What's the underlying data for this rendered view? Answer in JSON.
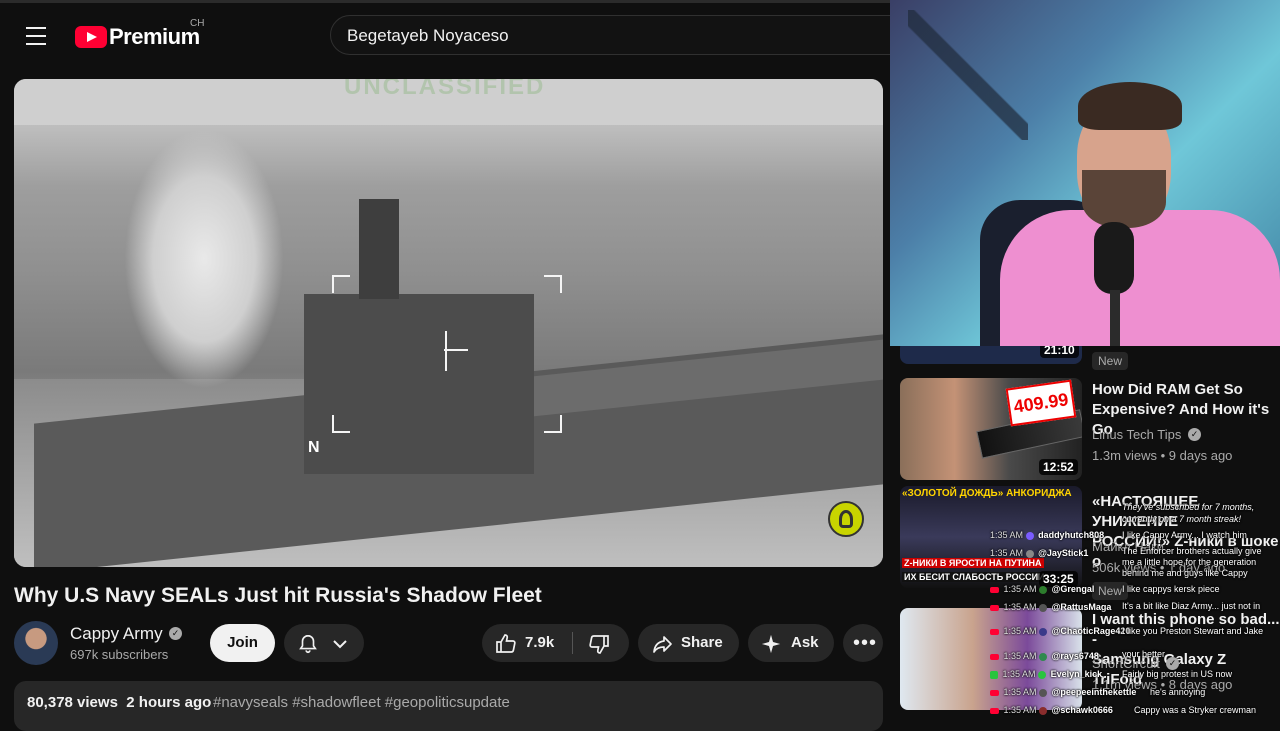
{
  "header": {
    "logo_text": "Premium",
    "logo_country": "CH",
    "search_value": "Begetayeb Noyaceso"
  },
  "player": {
    "overlay_letter": "N",
    "top_banner_text": "UNCLASSIFIED"
  },
  "video": {
    "title": "Why U.S Navy SEALs Just hit Russia's Shadow Fleet",
    "channel": "Cappy Army",
    "subscribers": "697k subscribers",
    "join_label": "Join",
    "likes": "7.9k",
    "share_label": "Share",
    "ask_label": "Ask",
    "views": "80,378 views",
    "age": "2 hours ago",
    "tags": "#navyseals #shadowfleet #geopoliticsupdate"
  },
  "recommendations": [
    {
      "new_badge": "New",
      "top_duration": "21:10"
    },
    {
      "title_line1": "How Did RAM Get So",
      "title_line2": "Expensive? And How it's Go",
      "channel": "Linus Tech Tips",
      "meta": "1.3m views  •  9 days ago",
      "duration": "12:52",
      "price_badge": "409.99"
    },
    {
      "title_line1": "«НАСТОЯЩЕЕ УНИЖЕНИЕ",
      "title_line2": "РОССИИ!» Z-ники в шоке о",
      "channel": "Майкл Наки",
      "meta": "506k views  •  1 day ago",
      "duration": "33:25",
      "thumb_top": "«ЗОЛОТОЙ ДОЖДЬ» АНКОРИДЖА",
      "thumb_mid": "Z-НИКИ В ЯРОСТИ НА ПУТИНА",
      "thumb_bot": "ИХ БЕСИТ СЛАБОСТЬ РОССИИ",
      "new_badge": "New"
    },
    {
      "title_line1": "I want this phone so bad... -",
      "title_line2": "Samsung Galaxy Z TriFold",
      "channel": "ShortCircuit",
      "meta": "1.1m views  •  8 days ago"
    }
  ],
  "chat": {
    "users": [
      {
        "time": "1:35 AM",
        "name": "daddyhutch808",
        "color": "#ffffff",
        "av": "#7a5cff"
      },
      {
        "time": "1:35 AM",
        "name": "@JayStick1",
        "color": "#ffffff",
        "av": "#888888"
      },
      {
        "time": "1:35 AM",
        "name": "@Grengal",
        "color": "#ffffff",
        "av": "#2d7d2d"
      },
      {
        "time": "1:35 AM",
        "name": "@RattusMaga",
        "color": "#ffffff",
        "av": "#555555"
      },
      {
        "time": "1:35 AM",
        "name": "@ChaoticRage420",
        "color": "#ffffff",
        "av": "#3a3a8a"
      },
      {
        "time": "1:35 AM",
        "name": "@rays6748",
        "color": "#ffffff",
        "av": "#2e8a4e"
      },
      {
        "time": "1:35 AM",
        "name": "Evelyn_kick",
        "color": "#ffffff",
        "av": "#29c43e"
      },
      {
        "time": "1:35 AM",
        "name": "@peepeeinthekettle",
        "color": "#ffffff",
        "av": "#555555"
      },
      {
        "time": "1:35 AM",
        "name": "@schawk0666",
        "color": "#ffffff",
        "av": "#8a2d2d"
      }
    ],
    "messages": [
      "They've subscribed for 7 months,",
      "currently on a 7 month streak!",
      "I like Cappy Army... I watch him",
      "The Enforcer brothers actually give",
      "me a little hope for the generation",
      "behind me and guys like Cappy",
      "I like cappys kersk piece",
      "It's a bit like Diaz Army... just not in",
      "I like you Preston Stewart and Jake",
      "your better",
      "Fairly big protest in US now",
      "he's annoying",
      "Cappy was a Stryker crewman"
    ]
  }
}
